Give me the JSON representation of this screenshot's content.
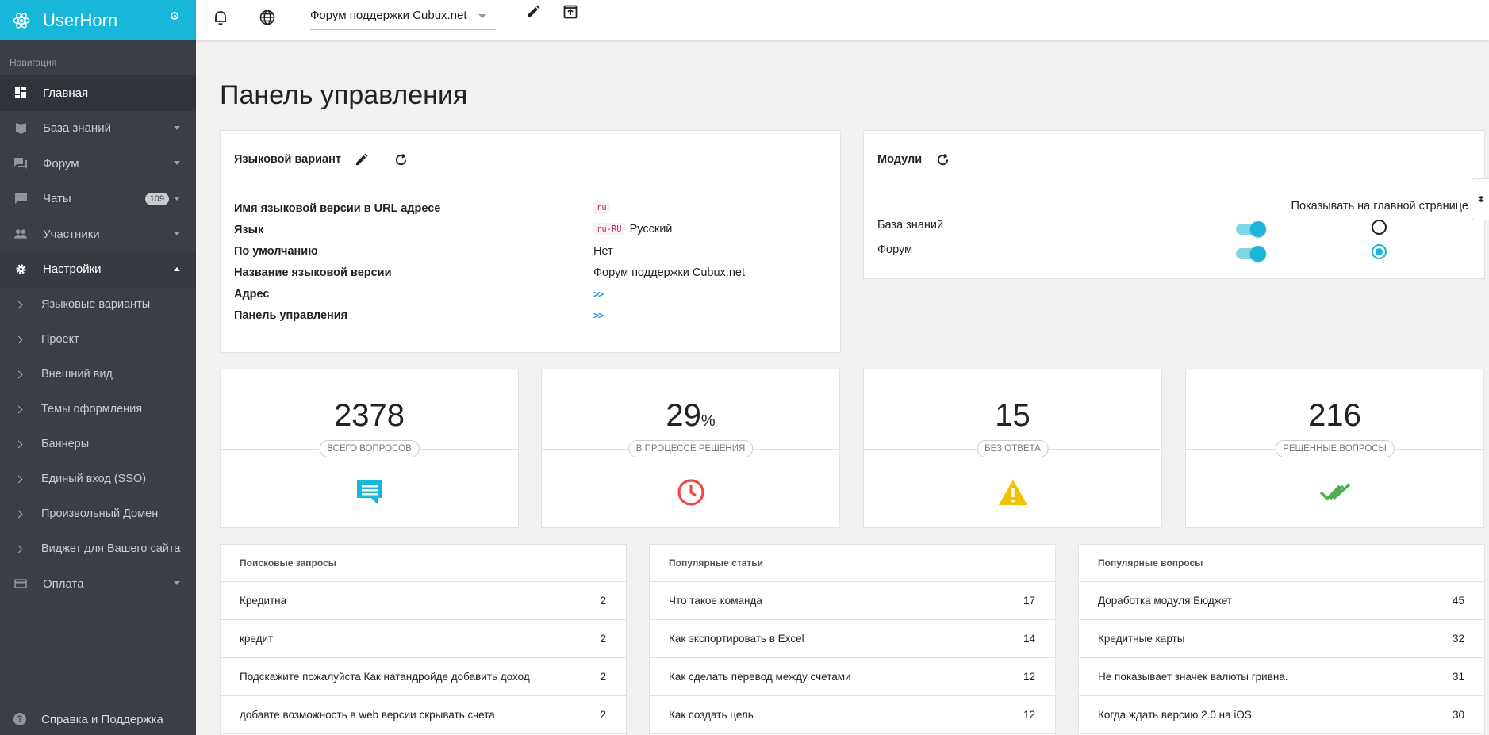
{
  "brand": {
    "name": "UserHorn"
  },
  "sidebar": {
    "section_label": "Навигация",
    "items": [
      {
        "label": "Главная"
      },
      {
        "label": "База знаний"
      },
      {
        "label": "Форум"
      },
      {
        "label": "Чаты",
        "badge": "109"
      },
      {
        "label": "Участники"
      },
      {
        "label": "Настройки"
      },
      {
        "label": "Оплата"
      }
    ],
    "settings_sub": [
      {
        "label": "Языковые варианты"
      },
      {
        "label": "Проект"
      },
      {
        "label": "Внешний вид"
      },
      {
        "label": "Темы оформления"
      },
      {
        "label": "Баннеры"
      },
      {
        "label": "Единый вход (SSO)"
      },
      {
        "label": "Произвольный Домен"
      },
      {
        "label": "Виджет для Вашего сайта"
      }
    ],
    "help_label": "Справка и Поддержка"
  },
  "topbar": {
    "project": "Форум поддержки Cubux.net"
  },
  "page": {
    "title": "Панель управления"
  },
  "language_card": {
    "title": "Языковой вариант",
    "rows": [
      {
        "key": "Имя языковой версии в URL адресе",
        "code": "ru",
        "value": ""
      },
      {
        "key": "Язык",
        "code": "ru-RU",
        "value": "Русский"
      },
      {
        "key": "По умолчанию",
        "code": "",
        "value": "Нет"
      },
      {
        "key": "Название языковой версии",
        "code": "",
        "value": "Форум поддержки Cubux.net"
      },
      {
        "key": "Адрес",
        "code": "",
        "value": ">>"
      },
      {
        "key": "Панель управления",
        "code": "",
        "value": ">>"
      }
    ]
  },
  "modules_card": {
    "title": "Модули",
    "column_header": "Показывать на главной странице",
    "rows": [
      {
        "label": "База знаний",
        "enabled": true,
        "on_main": false
      },
      {
        "label": "Форум",
        "enabled": true,
        "on_main": true
      }
    ]
  },
  "stats": [
    {
      "value": "2378",
      "unit": "",
      "label": "ВСЕГО ВОПРОСОВ",
      "icon": "chat-icon",
      "color": "#17b7d9"
    },
    {
      "value": "29",
      "unit": "%",
      "label": "В ПРОЦЕССЕ РЕШЕНИЯ",
      "icon": "clock-icon",
      "color": "#e94b4b"
    },
    {
      "value": "15",
      "unit": "",
      "label": "БЕЗ ОТВЕТА",
      "icon": "warning-icon",
      "color": "#f5c000"
    },
    {
      "value": "216",
      "unit": "",
      "label": "РЕШЕННЫЕ ВОПРОСЫ",
      "icon": "double-check-icon",
      "color": "#4caf50"
    }
  ],
  "lists": [
    {
      "title": "Поисковые запросы",
      "rows": [
        {
          "label": "Кредитна",
          "count": "2"
        },
        {
          "label": "кредит",
          "count": "2"
        },
        {
          "label": "Подскажите пожалуйста Как натандройде добавить доход",
          "count": "2"
        },
        {
          "label": "добавте возможность в web версии скрывать счета",
          "count": "2"
        }
      ]
    },
    {
      "title": "Популярные статьи",
      "rows": [
        {
          "label": "Что такое команда",
          "count": "17"
        },
        {
          "label": "Как экспортировать в Excel",
          "count": "14"
        },
        {
          "label": "Как сделать перевод между счетами",
          "count": "12"
        },
        {
          "label": "Как создать цель",
          "count": "12"
        }
      ]
    },
    {
      "title": "Популярные вопросы",
      "rows": [
        {
          "label": "Доработка модуля Бюджет",
          "count": "45"
        },
        {
          "label": "Кредитные карты",
          "count": "32"
        },
        {
          "label": "Не показывает значек валюты гривна.",
          "count": "31"
        },
        {
          "label": "Когда ждать версию 2.0 на iOS",
          "count": "30"
        }
      ]
    }
  ]
}
